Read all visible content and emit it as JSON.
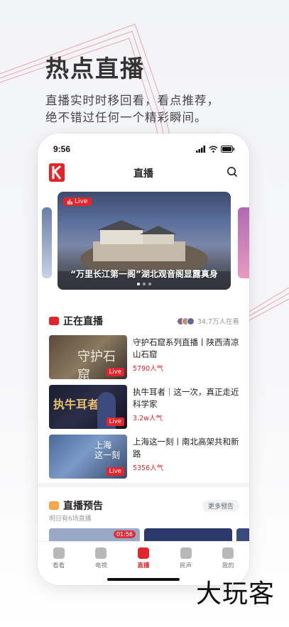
{
  "promo": {
    "headline": "热点直播",
    "subline1": "直播实时时移回看，看点推荐，",
    "subline2": "绝不错过任何一个精彩瞬间。"
  },
  "status_bar": {
    "time": "9:56"
  },
  "app_bar": {
    "title": "直播"
  },
  "banner": {
    "live_label": "Live",
    "caption": "“万里长江第一阁”湖北观音阁显露真身",
    "page_count": 3,
    "active_page": 1
  },
  "live_section": {
    "title": "正在直播",
    "viewers": "34.7万人在看",
    "items": [
      {
        "title": "守护石窟系列直播丨陕西清凉山石窟",
        "popularity": "5790人气",
        "live_label": "Live"
      },
      {
        "title": "执牛耳者｜这一次，真正走近科学家",
        "popularity": "3.2w人气",
        "live_label": "Live"
      },
      {
        "title": "上海这一刻丨南北高架共和新路",
        "popularity": "5356人气",
        "live_label": "Live"
      }
    ]
  },
  "preview_section": {
    "title": "直播预告",
    "more_label": "更多预告",
    "subtitle": "明日有6场直播",
    "first_time": "01:56"
  },
  "tabs": [
    {
      "label": "看看"
    },
    {
      "label": "电视"
    },
    {
      "label": "直播"
    },
    {
      "label": "民声"
    },
    {
      "label": "我的"
    }
  ],
  "watermark": "大玩客",
  "colors": {
    "accent": "#e2242b"
  }
}
